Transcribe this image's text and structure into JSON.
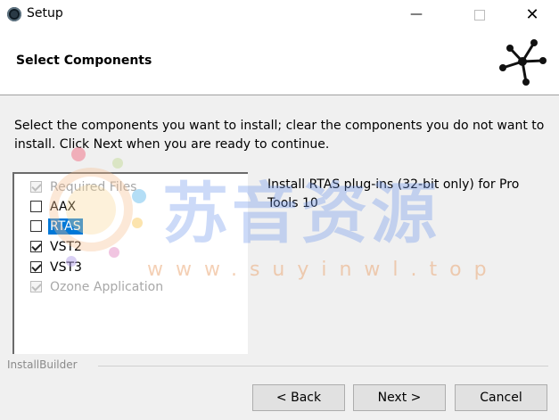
{
  "window": {
    "title": "Setup",
    "minimize_glyph": "—",
    "close_glyph": "✕"
  },
  "header": {
    "title": "Select Components",
    "logo_icon": "installbuilder-star-logo-icon"
  },
  "instructions": "Select the components you want to install; clear the components you do not want to install. Click Next when you are ready to continue.",
  "components": [
    {
      "label": "Required Files",
      "checked": true,
      "disabled": true,
      "selected": false
    },
    {
      "label": "AAX",
      "checked": false,
      "disabled": false,
      "selected": false
    },
    {
      "label": "RTAS",
      "checked": false,
      "disabled": false,
      "selected": true
    },
    {
      "label": "VST2",
      "checked": true,
      "disabled": false,
      "selected": false
    },
    {
      "label": "VST3",
      "checked": true,
      "disabled": false,
      "selected": false
    },
    {
      "label": "Ozone Application",
      "checked": true,
      "disabled": true,
      "selected": false
    }
  ],
  "description": "Install RTAS plug-ins (32-bit only) for Pro Tools 10",
  "footer": {
    "brand": "InstallBuilder",
    "back_label": "< Back",
    "next_label": "Next >",
    "cancel_label": "Cancel"
  },
  "watermark": {
    "text": "苏音资源",
    "url": "www.suyinwl.top"
  },
  "colors": {
    "selection": "#0078d7",
    "disabled_text": "#a8a8a8",
    "button_face": "#e1e1e1"
  }
}
